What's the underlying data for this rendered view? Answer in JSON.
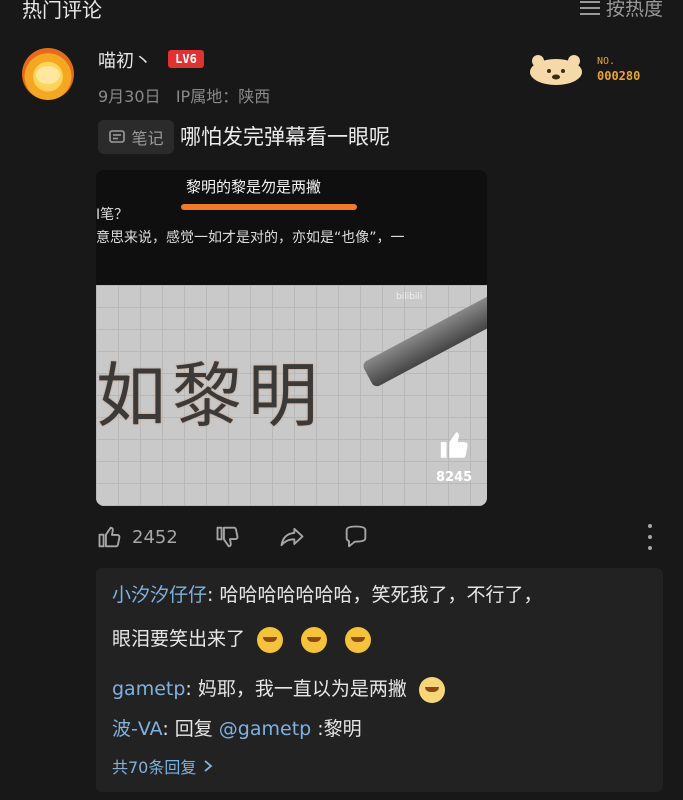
{
  "header": {
    "title": "热门评论",
    "sort_label": "按热度"
  },
  "comment": {
    "username": "喵初丶",
    "level": "LV6",
    "date": "9月30日",
    "location": "IP属地：陕西",
    "badge": {
      "no_label": "NO.",
      "number": "000280"
    },
    "note_tag": "笔记",
    "text": "哪怕发完弹幕看一眼呢",
    "image": {
      "caption_highlight": "黎明的黎是勿是两撇",
      "caption_line2": "I笔？",
      "caption_line3": "意思来说，感觉一如才是对的，亦如是“也像”，一",
      "handwriting": "如黎明",
      "watermark": "bilibili",
      "like_count": "8245"
    },
    "actions": {
      "like_count": "2452"
    }
  },
  "replies": [
    {
      "nick": "小汐汐仔仔",
      "text": ": 哈哈哈哈哈哈哈，笑死我了，不行了，",
      "text2": "眼泪要笑出来了"
    },
    {
      "nick": "gametp",
      "text": ": 妈耶，我一直以为是两撇"
    },
    {
      "nick": "波-VA",
      "text": ": 回复 ",
      "mention": "@gametp",
      "text2": " :黎明"
    }
  ],
  "more_replies": "共70条回复"
}
